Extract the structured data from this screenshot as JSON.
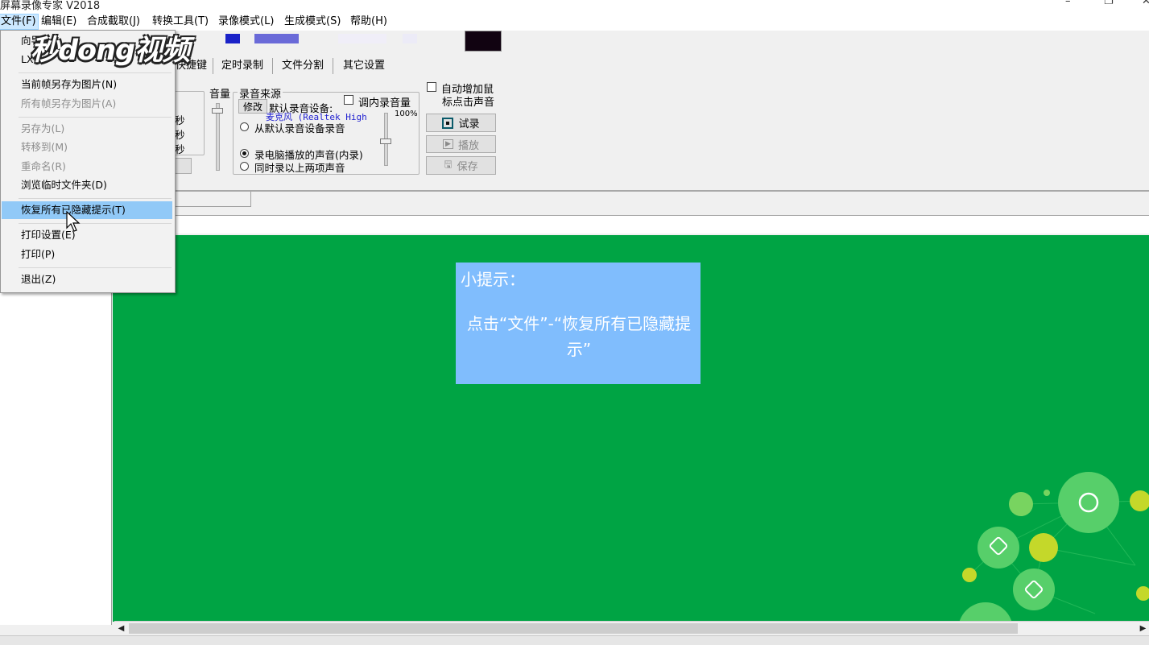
{
  "window": {
    "title": "屏幕录像专家 V2018",
    "controls": [
      "–",
      "❐",
      "✕"
    ]
  },
  "menubar": [
    {
      "label": "文件(F)",
      "active": true
    },
    {
      "label": "编辑(E)"
    },
    {
      "label": "合成截取(J)"
    },
    {
      "label": "转换工具(T)"
    },
    {
      "label": "录像模式(L)"
    },
    {
      "label": "生成模式(S)"
    },
    {
      "label": "帮助(H)"
    }
  ],
  "file_menu": {
    "items": [
      {
        "label": "向导",
        "enabled": true
      },
      {
        "label": "LX",
        "enabled": true
      },
      {
        "label": "当前帧另存为图片(N)",
        "enabled": true
      },
      {
        "label": "所有帧另存为图片(A)",
        "enabled": false
      },
      {
        "label": "另存为(L)",
        "enabled": false
      },
      {
        "label": "转移到(M)",
        "enabled": false
      },
      {
        "label": "重命名(R)",
        "enabled": false
      },
      {
        "label": "浏览临时文件夹(D)",
        "enabled": true
      },
      {
        "label": "恢复所有已隐藏提示(T)",
        "enabled": true,
        "highlighted": true
      },
      {
        "label": "打印设置(E)",
        "enabled": true
      },
      {
        "label": "打印(P)",
        "enabled": true
      },
      {
        "label": "退出(Z)",
        "enabled": true
      }
    ]
  },
  "watermark": {
    "text": "秒dong视频"
  },
  "tabs": [
    "快捷键",
    "定时录制",
    "文件分割",
    "其它设置"
  ],
  "time_fields": [
    "秒",
    "秒",
    "秒"
  ],
  "volume": {
    "label": "音量"
  },
  "audio_source": {
    "legend": "录音来源",
    "modify_button": "修改",
    "default_device_label": "默认录音设备:",
    "device_name": "麦克风 (Realtek High",
    "internal_volume_label": "调内录音量",
    "volume_percent": "100%",
    "options": [
      {
        "label": "从默认录音设备录音",
        "selected": false
      },
      {
        "label": "录电脑播放的声音(内录)",
        "selected": true
      },
      {
        "label": "同时录以上两项声音",
        "selected": false
      }
    ]
  },
  "click_sound": {
    "label_line1": "自动增加鼠",
    "label_line2": "标点击声音"
  },
  "buttons": {
    "test": "试录",
    "play": "播放",
    "save": "保存"
  },
  "hint": {
    "title": "小提示：",
    "text": "点击“文件”-“恢复所有已隐藏提示”"
  },
  "colors": {
    "green_area": "#00a444",
    "hint_bg": "#80bdfd",
    "menu_highlight": "#91c9f7"
  }
}
